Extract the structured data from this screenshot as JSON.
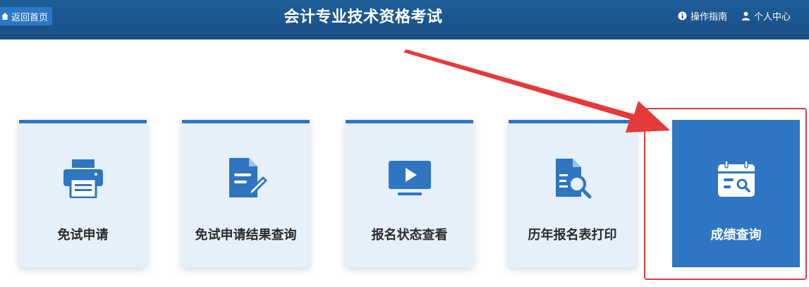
{
  "header": {
    "back_label": "返回首页",
    "title": "会计专业技术资格考试",
    "guide_label": "操作指南",
    "user_center_label": "个人中心"
  },
  "cards": [
    {
      "label": "免试申请",
      "icon": "printer-icon"
    },
    {
      "label": "免试申请结果查询",
      "icon": "document-edit-icon"
    },
    {
      "label": "报名状态查看",
      "icon": "play-monitor-icon"
    },
    {
      "label": "历年报名表打印",
      "icon": "document-search-icon"
    },
    {
      "label": "成绩查询",
      "icon": "calendar-search-icon",
      "selected": true
    }
  ],
  "colors": {
    "header_bg": "#1a4f86",
    "accent": "#2d76c3",
    "card_bg": "#e5f0fb",
    "annotation_red": "#e53a3a"
  }
}
